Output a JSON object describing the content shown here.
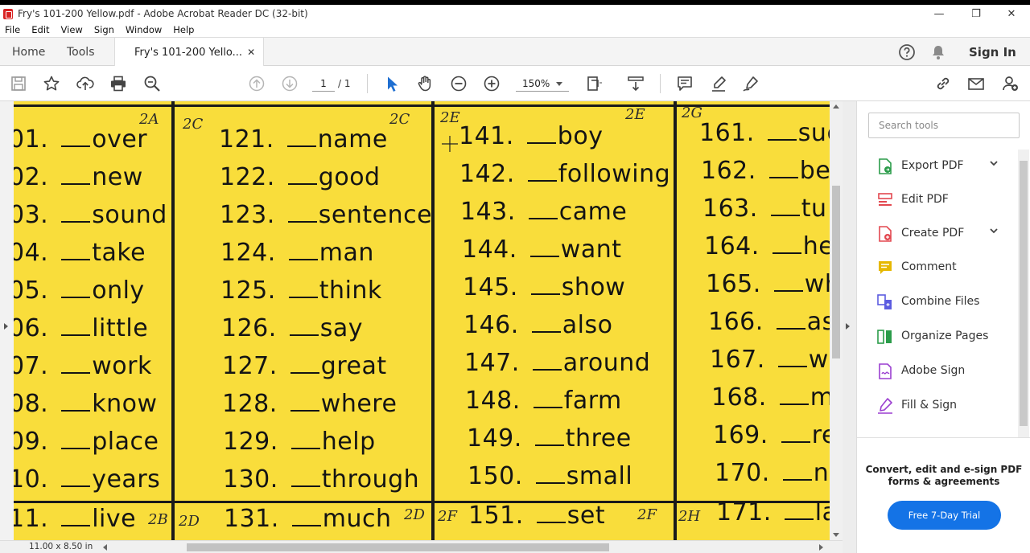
{
  "window": {
    "title": "Fry's 101-200 Yellow.pdf - Adobe Acrobat Reader DC (32-bit)",
    "minimize": "—",
    "maximize": "❐",
    "close": "✕"
  },
  "menu": [
    "File",
    "Edit",
    "View",
    "Sign",
    "Window",
    "Help"
  ],
  "tabs": {
    "home": "Home",
    "tools": "Tools",
    "document": "Fry's 101-200 Yello...",
    "document_close": "✕",
    "sign_in": "Sign In"
  },
  "toolbar": {
    "page_current": "1",
    "page_total": "/ 1",
    "zoom": "150%"
  },
  "document": {
    "columns": [
      {
        "entries": [
          {
            "num": "01.",
            "word": "over"
          },
          {
            "num": "02.",
            "word": "new"
          },
          {
            "num": "03.",
            "word": "sound"
          },
          {
            "num": "04.",
            "word": "take"
          },
          {
            "num": "05.",
            "word": "only"
          },
          {
            "num": "06.",
            "word": "little"
          },
          {
            "num": "07.",
            "word": "work"
          },
          {
            "num": "08.",
            "word": "know"
          },
          {
            "num": "09.",
            "word": "place"
          },
          {
            "num": "10.",
            "word": "years"
          },
          {
            "num": "11.",
            "word": "live"
          }
        ]
      },
      {
        "entries": [
          {
            "num": "121.",
            "word": "name"
          },
          {
            "num": "122.",
            "word": "good"
          },
          {
            "num": "123.",
            "word": "sentence"
          },
          {
            "num": "124.",
            "word": "man"
          },
          {
            "num": "125.",
            "word": "think"
          },
          {
            "num": "126.",
            "word": "say"
          },
          {
            "num": "127.",
            "word": "great"
          },
          {
            "num": "128.",
            "word": "where"
          },
          {
            "num": "129.",
            "word": "help"
          },
          {
            "num": "130.",
            "word": "through"
          },
          {
            "num": "131.",
            "word": "much"
          }
        ]
      },
      {
        "entries": [
          {
            "num": "141.",
            "word": "boy"
          },
          {
            "num": "142.",
            "word": "following"
          },
          {
            "num": "143.",
            "word": "came"
          },
          {
            "num": "144.",
            "word": "want"
          },
          {
            "num": "145.",
            "word": "show"
          },
          {
            "num": "146.",
            "word": "also"
          },
          {
            "num": "147.",
            "word": "around"
          },
          {
            "num": "148.",
            "word": "farm"
          },
          {
            "num": "149.",
            "word": "three"
          },
          {
            "num": "150.",
            "word": "small"
          },
          {
            "num": "151.",
            "word": "set"
          }
        ]
      },
      {
        "entries": [
          {
            "num": "161.",
            "word": "suc"
          },
          {
            "num": "162.",
            "word": "be"
          },
          {
            "num": "163.",
            "word": "tu"
          },
          {
            "num": "164.",
            "word": "he"
          },
          {
            "num": "165.",
            "word": "wh"
          },
          {
            "num": "166.",
            "word": "as"
          },
          {
            "num": "167.",
            "word": "we"
          },
          {
            "num": "168.",
            "word": "m"
          },
          {
            "num": "169.",
            "word": "re"
          },
          {
            "num": "170.",
            "word": "ne"
          },
          {
            "num": "171.",
            "word": "lar"
          }
        ]
      }
    ],
    "handwritten_notes": [
      "2A",
      "2C",
      "2C",
      "2E",
      "2E",
      "2G",
      "2B",
      "2D",
      "2D",
      "2F",
      "2F",
      "2H"
    ],
    "page_size": "11.00 x 8.50 in"
  },
  "panel": {
    "search_placeholder": "Search tools",
    "tools": [
      {
        "label": "Export PDF",
        "icon": "export-pdf-icon",
        "color": "#2b9c4a"
      },
      {
        "label": "Edit PDF",
        "icon": "edit-pdf-icon",
        "color": "#e34850"
      },
      {
        "label": "Create PDF",
        "icon": "create-pdf-icon",
        "color": "#e34850"
      },
      {
        "label": "Comment",
        "icon": "comment-icon",
        "color": "#e6b800"
      },
      {
        "label": "Combine Files",
        "icon": "combine-files-icon",
        "color": "#5c5ce0"
      },
      {
        "label": "Organize Pages",
        "icon": "organize-pages-icon",
        "color": "#2b9c4a"
      },
      {
        "label": "Adobe Sign",
        "icon": "adobe-sign-icon",
        "color": "#9b3fd0"
      },
      {
        "label": "Fill & Sign",
        "icon": "fill-sign-icon",
        "color": "#9b3fd0"
      }
    ],
    "promo_text": "Convert, edit and e-sign PDF forms & agreements",
    "trial_button": "Free 7-Day Trial"
  }
}
